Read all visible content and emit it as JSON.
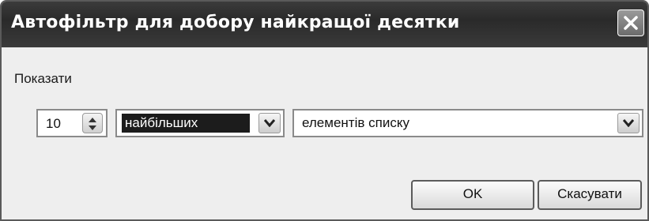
{
  "dialog": {
    "title": "Автофільтр для добору найкращої десятки"
  },
  "group": {
    "label": "Показати"
  },
  "count": {
    "value": "10"
  },
  "order": {
    "selected": "найбільших"
  },
  "type": {
    "selected": "елементів списку"
  },
  "buttons": {
    "ok": "OK",
    "cancel": "Скасувати"
  }
}
